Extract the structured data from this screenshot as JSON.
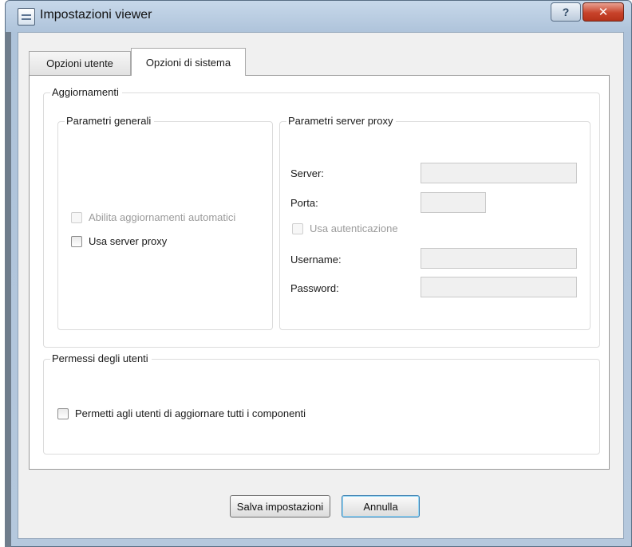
{
  "window": {
    "title": "Impostazioni viewer",
    "help_glyph": "?",
    "close_glyph": "✕",
    "title_icon": "settings-document-icon"
  },
  "tabs": [
    {
      "label": "Opzioni utente",
      "selected": false
    },
    {
      "label": "Opzioni di sistema",
      "selected": true
    }
  ],
  "updates": {
    "title": "Aggiornamenti",
    "general": {
      "title": "Parametri generali",
      "auto_updates": {
        "label": "Abilita aggiornamenti automatici",
        "checked": false,
        "enabled": false
      },
      "use_proxy": {
        "label": "Usa server proxy",
        "checked": false,
        "enabled": true
      }
    },
    "proxy": {
      "title": "Parametri server proxy",
      "server": {
        "label": "Server:",
        "value": ""
      },
      "port": {
        "label": "Porta:",
        "value": ""
      },
      "use_auth": {
        "label": "Usa autenticazione",
        "checked": false,
        "enabled": false
      },
      "username": {
        "label": "Username:",
        "value": ""
      },
      "password": {
        "label": "Password:",
        "value": ""
      }
    }
  },
  "permissions": {
    "title": "Permessi degli utenti",
    "allow_update_all": {
      "label": "Permetti agli utenti di aggiornare tutti i componenti",
      "checked": false,
      "enabled": true
    }
  },
  "buttons": {
    "save": "Salva impostazioni",
    "cancel": "Annulla"
  },
  "colors": {
    "titlebar": "#b5c8dd",
    "close_button": "#c8432b",
    "focus_border": "#3c7fb1"
  }
}
